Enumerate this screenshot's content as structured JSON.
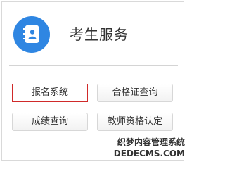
{
  "header": {
    "title": "考生服务",
    "icon": "address-book-icon"
  },
  "buttons": [
    {
      "label": "报名系统",
      "selected": true
    },
    {
      "label": "合格证查询",
      "selected": false
    },
    {
      "label": "成绩查询",
      "selected": false
    },
    {
      "label": "教师资格认定",
      "selected": false
    }
  ],
  "watermark": {
    "line1": "织梦内容管理系统",
    "line2": "DEDECMS.COM"
  },
  "colors": {
    "icon_bg": "#2f86e2",
    "selected_border": "#d02a2a"
  }
}
